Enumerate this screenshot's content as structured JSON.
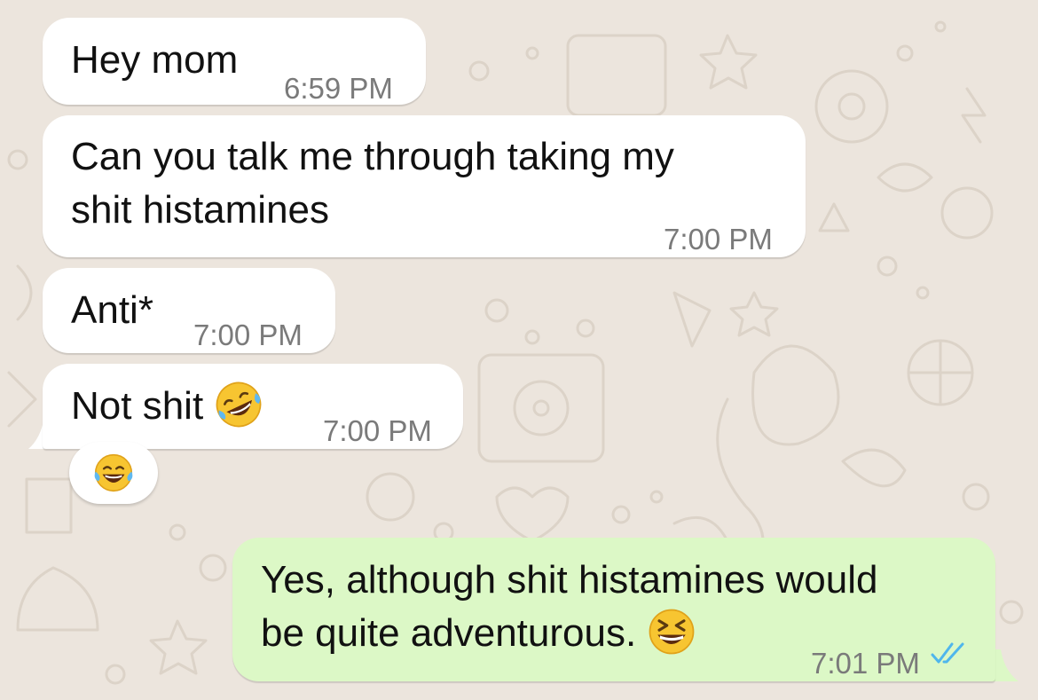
{
  "messages": [
    {
      "text": "Hey mom",
      "time": "6:59 PM"
    },
    {
      "text": "Can you talk me through taking my\nshit histamines",
      "time": "7:00 PM"
    },
    {
      "text": "Anti*",
      "time": "7:00 PM"
    },
    {
      "text": "Not shit",
      "emoji": "rolling-on-floor-laughing",
      "time": "7:00 PM",
      "reaction": "face-with-tears-of-joy"
    },
    {
      "text": "Yes, although shit histamines would\nbe quite adventurous.",
      "emoji": "grinning-squinting-face",
      "time": "7:01 PM",
      "status": "read"
    }
  ],
  "colors": {
    "background": "#ece5dd",
    "incoming_bubble": "#ffffff",
    "outgoing_bubble": "#dcf8c6",
    "read_ticks": "#4fb6ec",
    "timestamp": "#7a7a7a"
  }
}
